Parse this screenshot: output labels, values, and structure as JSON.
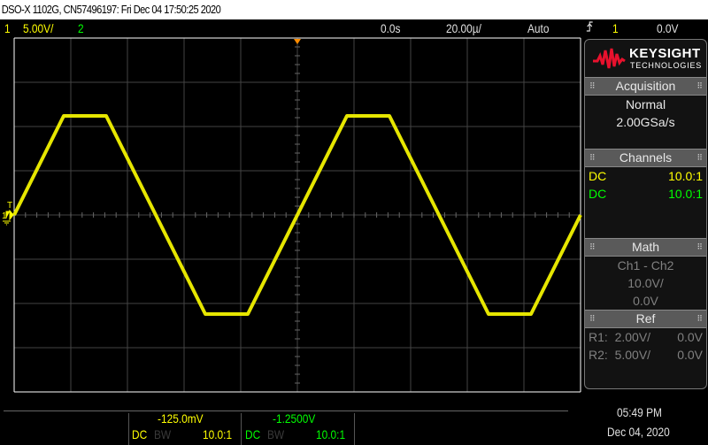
{
  "title": "DSO-X 1102G, CN57496197: Fri Dec 04 17:50:25 2020",
  "topbar": {
    "ch1_num": "1",
    "ch1_scale": "5.00V/",
    "ch2_num": "2",
    "time_delay": "0.0s",
    "time_scale": "20.00µ/",
    "trigger_mode": "Auto",
    "trigger_edge_icon": "rising-edge-icon",
    "trigger_source": "1",
    "trigger_level": "0.0V"
  },
  "graticule": {
    "ch1_marker": "1",
    "trigger_marker": "T"
  },
  "panel": {
    "logo": {
      "brand": "KEYSIGHT",
      "sub": "TECHNOLOGIES"
    },
    "acquisition": {
      "header": "Acquisition",
      "mode": "Normal",
      "rate": "2.00GSa/s"
    },
    "channels": {
      "header": "Channels",
      "rows": [
        {
          "coupling": "DC",
          "probe": "10.0:1",
          "color": "#ffff00"
        },
        {
          "coupling": "DC",
          "probe": "10.0:1",
          "color": "#00ff00"
        }
      ]
    },
    "math": {
      "header": "Math",
      "function": "Ch1 - Ch2",
      "scale": "10.0V/",
      "offset": "0.0V"
    },
    "ref": {
      "header": "Ref",
      "rows": [
        {
          "name": "R1:",
          "scale": "2.00V/",
          "offset": "0.0V"
        },
        {
          "name": "R2:",
          "scale": "5.00V/",
          "offset": "0.0V"
        }
      ]
    }
  },
  "bottom": {
    "ch1": {
      "offset": "-125.0mV",
      "coupling": "DC",
      "bw": "BW",
      "probe": "10.0:1"
    },
    "ch2": {
      "offset": "-1.2500V",
      "coupling": "DC",
      "bw": "BW",
      "probe": "10.0:1"
    },
    "time": "05:49 PM",
    "date": "Dec 04, 2020"
  },
  "colors": {
    "ch1": "#ffff00",
    "ch2": "#00ff00",
    "grid": "#444444",
    "brand": "#e8112d"
  }
}
